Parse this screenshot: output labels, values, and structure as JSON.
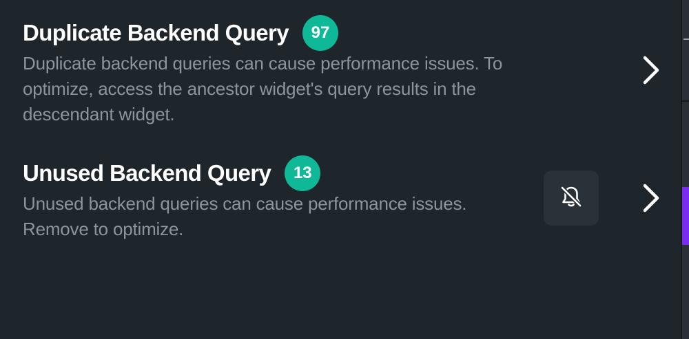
{
  "issues": [
    {
      "title": "Duplicate Backend Query",
      "count": "97",
      "description": "Duplicate backend queries can cause performance issues. To optimize, access the ancestor widget's query results in the descendant widget."
    },
    {
      "title": "Unused Backend Query",
      "count": "13",
      "description": "Unused backend queries can cause performance issues. Remove to optimize."
    }
  ],
  "icons": {
    "chevron": "chevron-right-icon",
    "mute": "bell-off-icon"
  },
  "colors": {
    "background": "#1e252b",
    "badge": "#0fb896",
    "title": "#ffffff",
    "description": "#8c959c",
    "button_bg": "#2a3239",
    "accent_strip": "#7a2cf2"
  }
}
